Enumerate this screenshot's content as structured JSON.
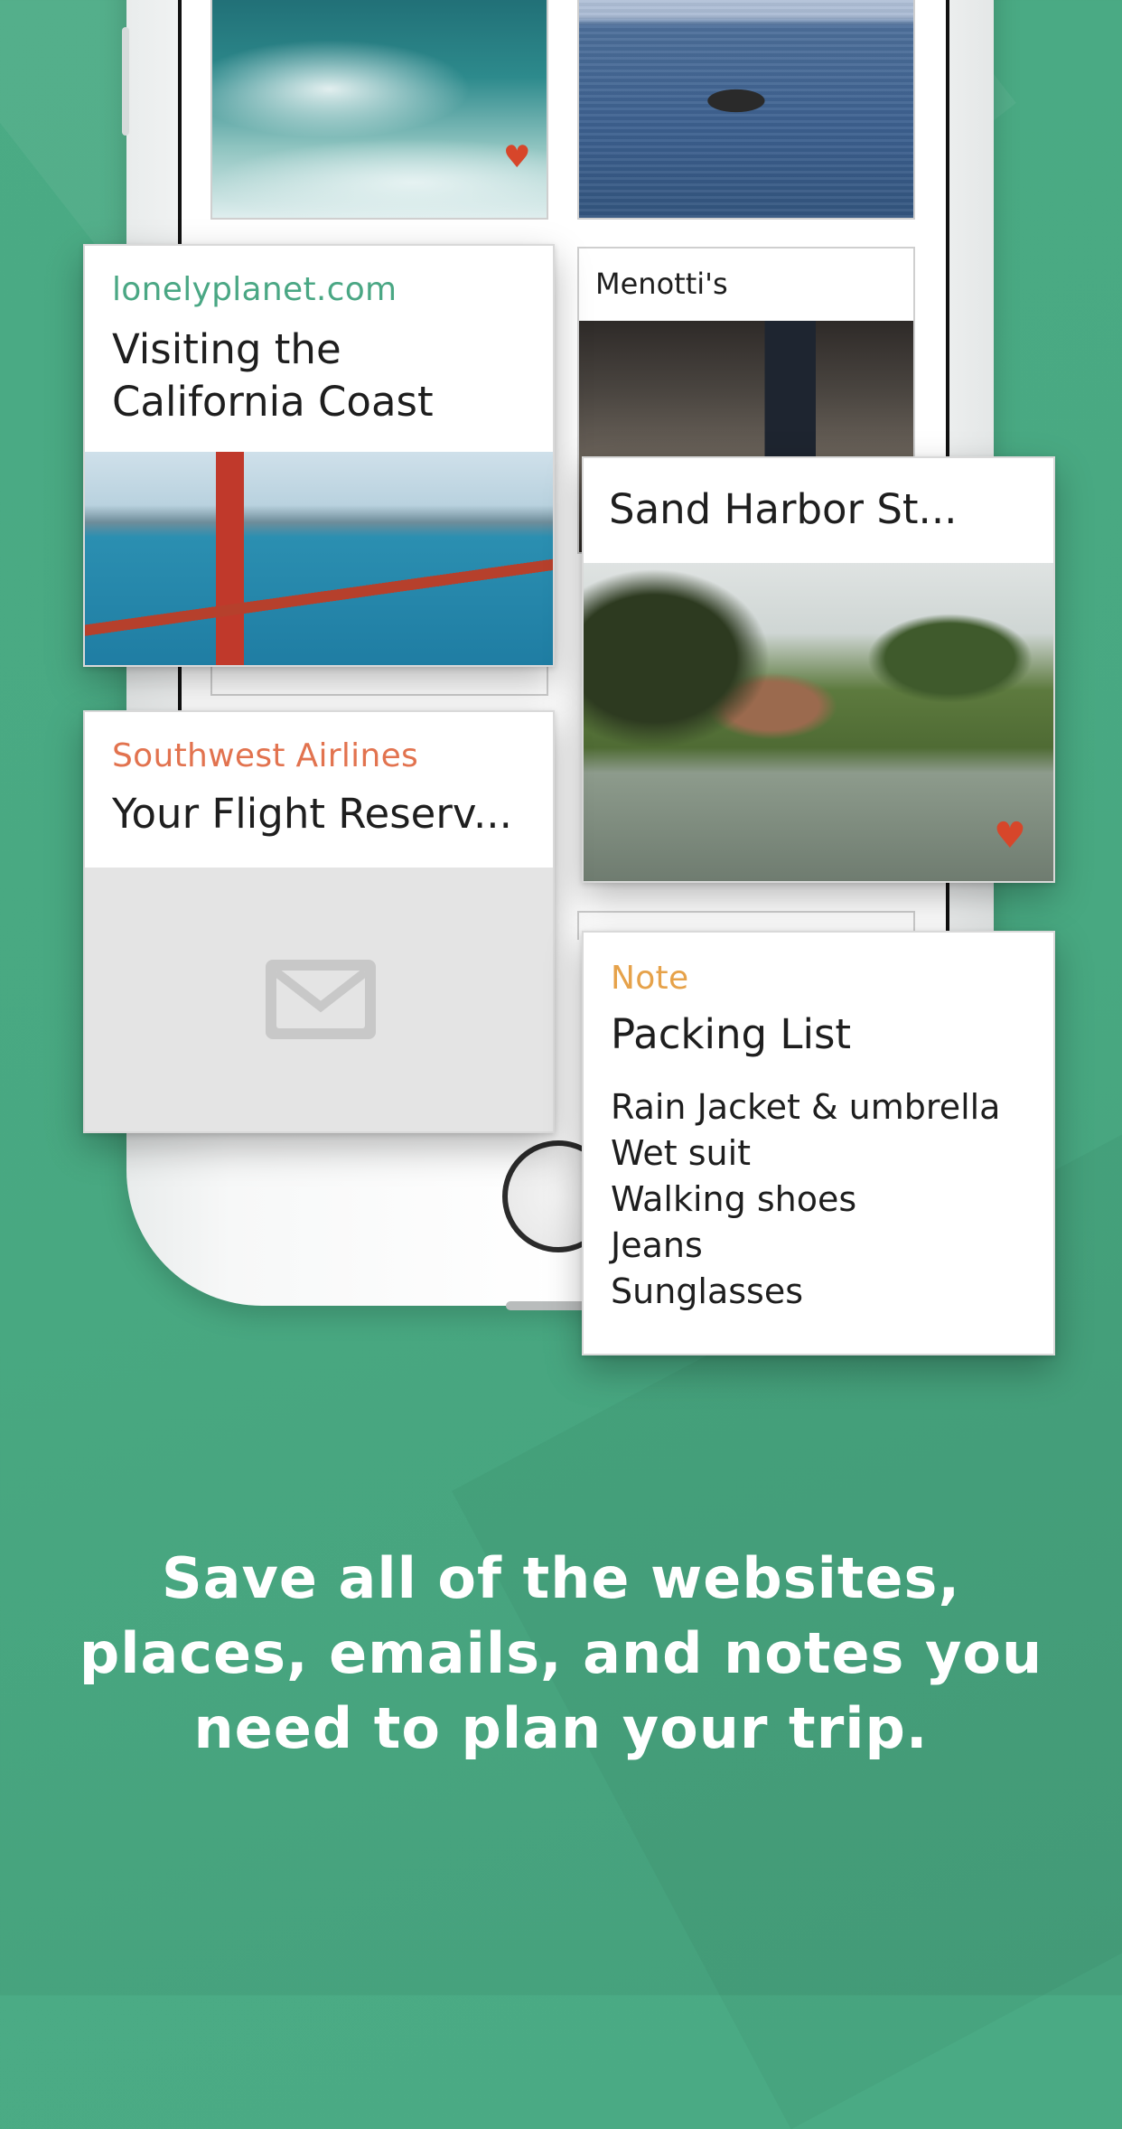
{
  "tiles": {
    "menottis_label": "Menotti's"
  },
  "cards": {
    "website": {
      "source": "lonelyplanet.com",
      "title_line1": "Visiting the",
      "title_line2": "California Coast"
    },
    "place": {
      "title": "Sand Harbor St..."
    },
    "email": {
      "source": "Southwest Airlines",
      "title": "Your Flight Reserv..."
    },
    "note": {
      "type": "Note",
      "title": "Packing List",
      "items": [
        "Rain Jacket & umbrella",
        "Wet suit",
        "Walking shoes",
        "Jeans",
        "Sunglasses"
      ]
    }
  },
  "colors": {
    "background": "#4bab85",
    "website_source": "#4aa784",
    "email_source": "#e2734f",
    "note_type": "#e6a24a",
    "heart": "#d7462a"
  },
  "tagline": {
    "line1": "Save all of the websites,",
    "line2": "places, emails, and notes you",
    "line3": "need to plan your trip."
  }
}
